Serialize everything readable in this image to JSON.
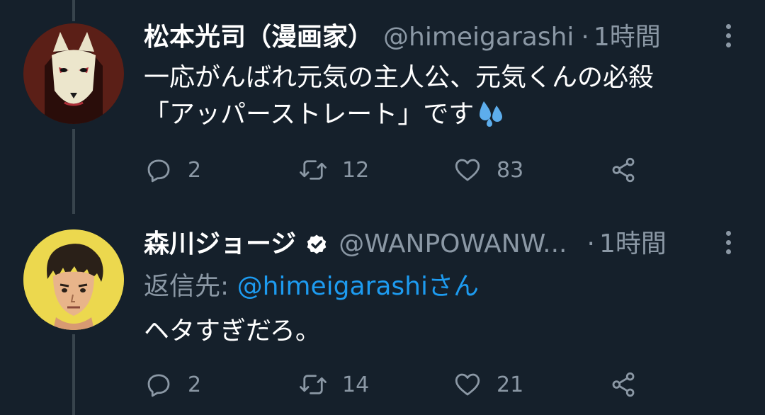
{
  "tweets": [
    {
      "display_name": "松本光司（漫画家）",
      "handle": "@himeigarashi",
      "dot": "·",
      "time": "1時間",
      "verified": false,
      "avatar": "fox-mask-avatar",
      "text_lines": [
        "一応がんばれ元気の主人公、元気くんの必殺",
        "「アッパーストレート」です"
      ],
      "emoji": "sweat-droplets-icon",
      "replies": "2",
      "retweets": "12",
      "likes": "83"
    },
    {
      "display_name": "森川ジョージ",
      "handle": "@WANPOWANW...",
      "dot": "·",
      "time": "1時間",
      "verified": true,
      "avatar": "boxer-avatar",
      "reply_label": "返信先: ",
      "reply_mention": "@himeigarashiさん",
      "text_lines": [
        "ヘタすぎだろ。"
      ],
      "replies": "2",
      "retweets": "14",
      "likes": "21"
    }
  ],
  "colors": {
    "background": "#15202b",
    "secondary_text": "#8b98a5",
    "accent": "#1d9bf0",
    "thread_line": "#38444d"
  }
}
